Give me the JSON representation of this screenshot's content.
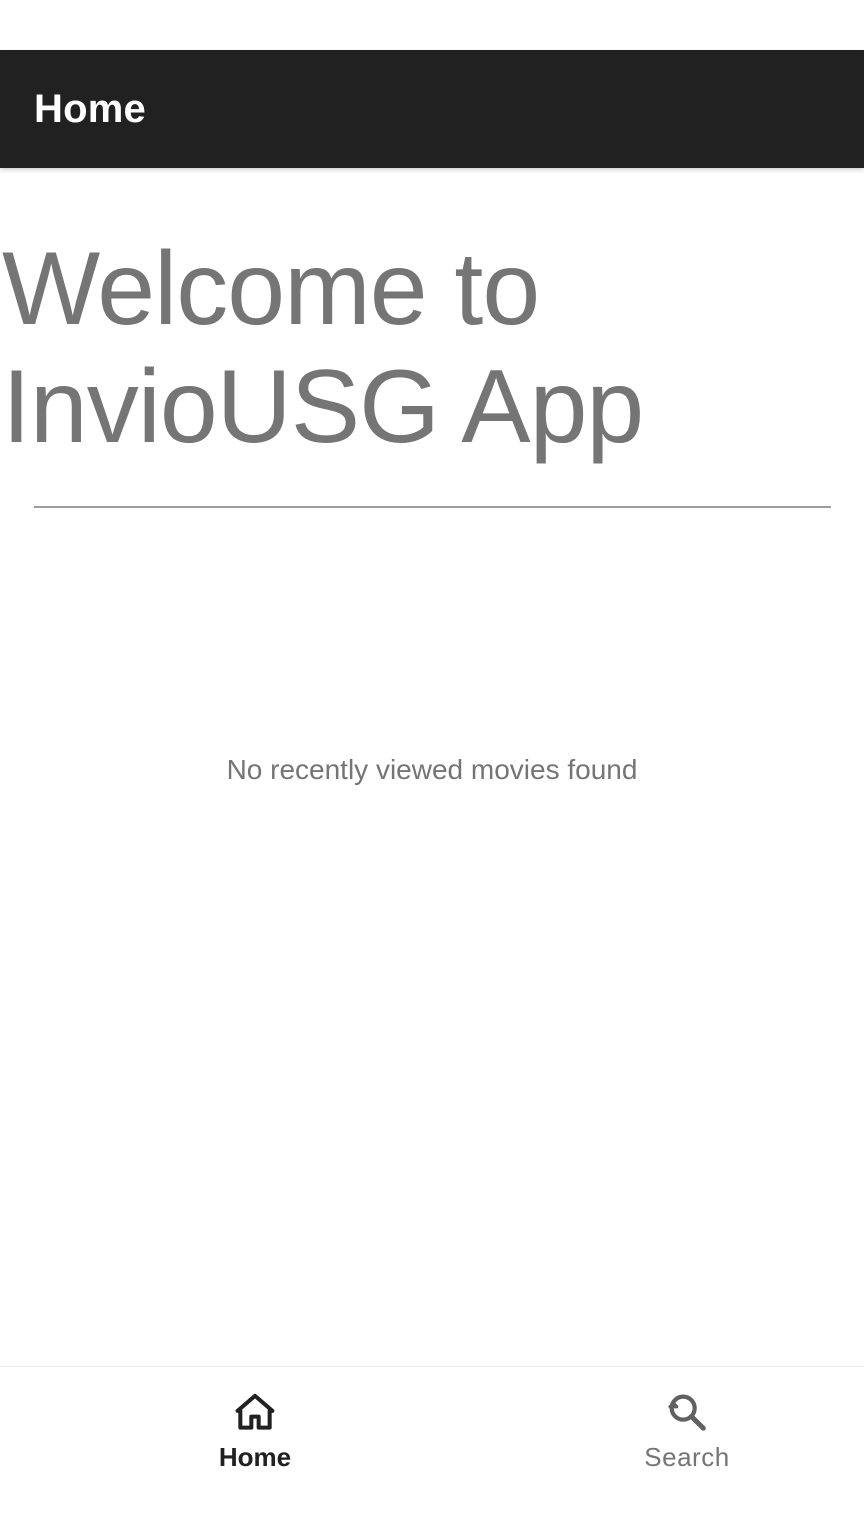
{
  "app_bar": {
    "title": "Home"
  },
  "main": {
    "welcome_title": "Welcome to InvioUSG App",
    "empty_message": "No recently viewed movies found"
  },
  "bottom_nav": {
    "items": [
      {
        "label": "Home",
        "icon": "home-icon",
        "active": true
      },
      {
        "label": "Search",
        "icon": "search-icon",
        "active": false
      }
    ]
  },
  "colors": {
    "app_bar_bg": "#212121",
    "title_gray": "#757575",
    "divider": "#9e9e9e",
    "active_nav": "#212121",
    "inactive_nav": "#757575"
  }
}
